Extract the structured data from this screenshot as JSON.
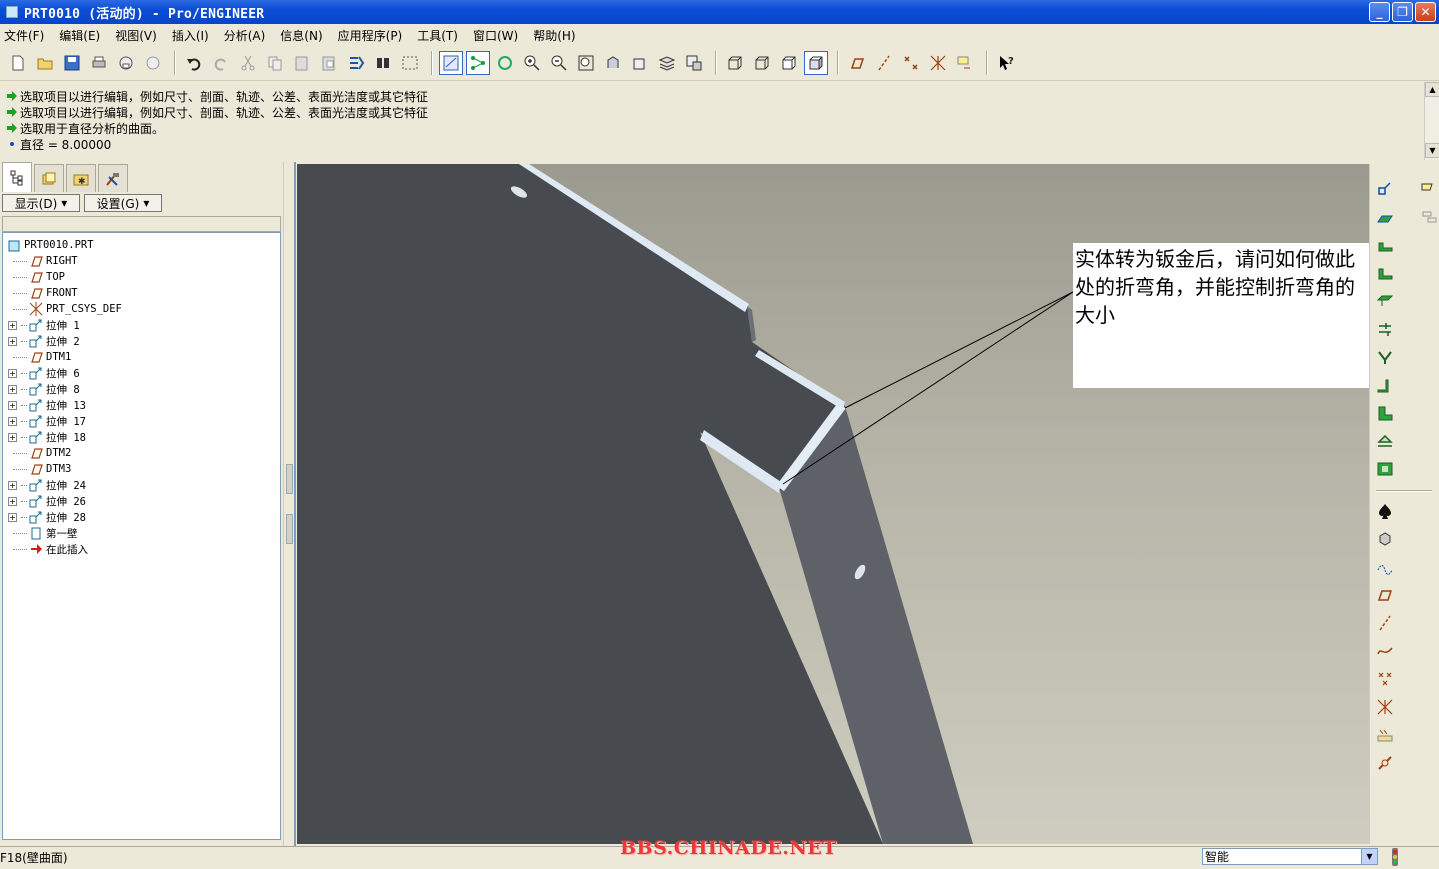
{
  "window": {
    "title": "PRT0010 (活动的) - Pro/ENGINEER",
    "buttons": {
      "min": "_",
      "max": "❐",
      "close": "✕"
    }
  },
  "menu": [
    "文件(F)",
    "编辑(E)",
    "视图(V)",
    "插入(I)",
    "分析(A)",
    "信息(N)",
    "应用程序(P)",
    "工具(T)",
    "窗口(W)",
    "帮助(H)"
  ],
  "messages": [
    "选取项目以进行编辑，例如尺寸、剖面、轨迹、公差、表面光洁度或其它特征",
    "选取项目以进行编辑，例如尺寸、剖面、轨迹、公差、表面光洁度或其它特征",
    "选取用于直径分析的曲面。"
  ],
  "diameter_msg": "直径 = 8.00000",
  "panel": {
    "show_btn": "显示(D)",
    "settings_btn": "设置(G)"
  },
  "tree": [
    {
      "label": "PRT0010.PRT",
      "icon": "part-icon",
      "expand": false,
      "root": true
    },
    {
      "label": "RIGHT",
      "icon": "datum-plane-icon",
      "expand": false
    },
    {
      "label": "TOP",
      "icon": "datum-plane-icon",
      "expand": false
    },
    {
      "label": "FRONT",
      "icon": "datum-plane-icon",
      "expand": false
    },
    {
      "label": "PRT_CSYS_DEF",
      "icon": "csys-icon",
      "expand": false
    },
    {
      "label": "拉伸 1",
      "icon": "extrude-icon",
      "expand": true
    },
    {
      "label": "拉伸 2",
      "icon": "extrude-icon",
      "expand": true
    },
    {
      "label": "DTM1",
      "icon": "datum-plane-icon",
      "expand": false
    },
    {
      "label": "拉伸 6",
      "icon": "extrude-icon",
      "expand": true
    },
    {
      "label": "拉伸 8",
      "icon": "extrude-icon",
      "expand": true
    },
    {
      "label": "拉伸 13",
      "icon": "extrude-icon",
      "expand": true
    },
    {
      "label": "拉伸 17",
      "icon": "extrude-icon",
      "expand": true
    },
    {
      "label": "拉伸 18",
      "icon": "extrude-icon",
      "expand": true
    },
    {
      "label": "DTM2",
      "icon": "datum-plane-icon",
      "expand": false
    },
    {
      "label": "DTM3",
      "icon": "datum-plane-icon",
      "expand": false
    },
    {
      "label": "拉伸 24",
      "icon": "extrude-icon",
      "expand": true
    },
    {
      "label": "拉伸 26",
      "icon": "extrude-icon",
      "expand": true
    },
    {
      "label": "拉伸 28",
      "icon": "extrude-icon",
      "expand": true
    },
    {
      "label": "第一壁",
      "icon": "wall-icon",
      "expand": false
    },
    {
      "label": "在此插入",
      "icon": "insert-here-icon",
      "expand": false
    }
  ],
  "annotation": "实体转为钣金后，请问如何做此处的折弯角，并能控制折弯角的大小",
  "status": {
    "text": "F18(壁曲面)",
    "filter": "智能"
  },
  "watermark": "BBS.CHINADE.NET",
  "colors": {
    "title_bar": "#0a4ed6",
    "model_dark": "#474b50",
    "model_side": "#5d6167",
    "edge_highlight": "#dfe9f3",
    "background": "#b7b5a8"
  }
}
